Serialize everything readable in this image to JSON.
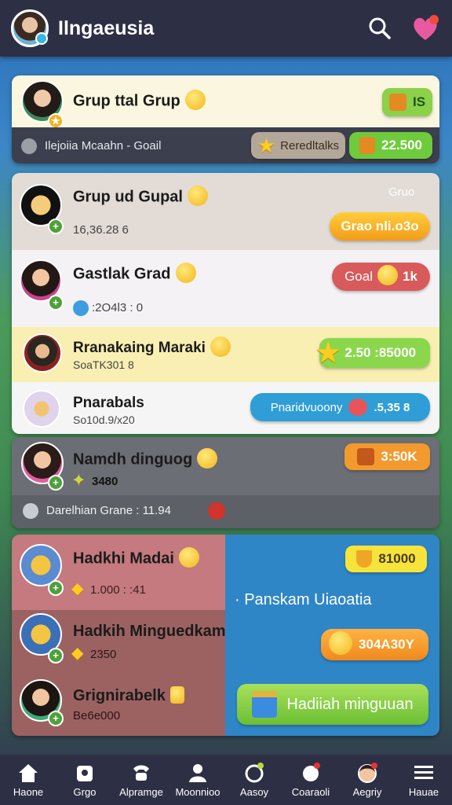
{
  "header": {
    "title": "Ilngaeusia",
    "search_icon": "search-icon",
    "heart_icon": "heart-icon"
  },
  "card1": {
    "name": "Grup ttal Grup",
    "badge_value": "IS",
    "footer_text": "Ilejoiia Mcaahn - Goail",
    "rewards_label": "Reredltalks",
    "coins_value": "22.500"
  },
  "card2": {
    "rows": [
      {
        "name": "Grup ud Gupal",
        "sub": "16,36.28 6",
        "corner": "Gruo",
        "button": "Grao nli.o3o"
      },
      {
        "name": "Gastlak Grad",
        "sub": ":2O4l3 : 0",
        "button": "Goal",
        "button_value": "1k"
      },
      {
        "name": "Rranakaing Maraki",
        "sub": "SoaTK301 8",
        "button": "2.50 :85000"
      },
      {
        "name": "Pnarabals",
        "sub": "So10d.9/x20",
        "button": "Pnaridvuoony",
        "button_value": ".5,35 8"
      }
    ]
  },
  "card3": {
    "name": "Namdh dinguog",
    "sub": "3480",
    "button": "3:50K",
    "footer_text": "Darelhian Grane : 11.94"
  },
  "card4": {
    "left_rows": [
      {
        "name": "Hadkhi Madai",
        "sub": "1.000 :   :41"
      },
      {
        "name": "Hadkih Minguedkam",
        "sub": "2350"
      },
      {
        "name": "Grignirabelk",
        "sub": "Be6e000"
      }
    ],
    "right": {
      "top_button": "81000",
      "title": "Panskam Uiaoatia",
      "mid_button": "304A30Y",
      "cta": "Hadiiah minguuan"
    }
  },
  "bottom_nav": [
    {
      "label": "Haone",
      "icon": "home-icon"
    },
    {
      "label": "Grgo",
      "icon": "group-icon"
    },
    {
      "label": "Alpramge",
      "icon": "phone-icon"
    },
    {
      "label": "Moonnioo",
      "icon": "profile-icon"
    },
    {
      "label": "Aasoy",
      "icon": "coin-icon"
    },
    {
      "label": "Coaraoli",
      "icon": "gift-icon"
    },
    {
      "label": "Aegriy",
      "icon": "avatar-icon"
    },
    {
      "label": "Hauae",
      "icon": "menu-icon"
    }
  ]
}
